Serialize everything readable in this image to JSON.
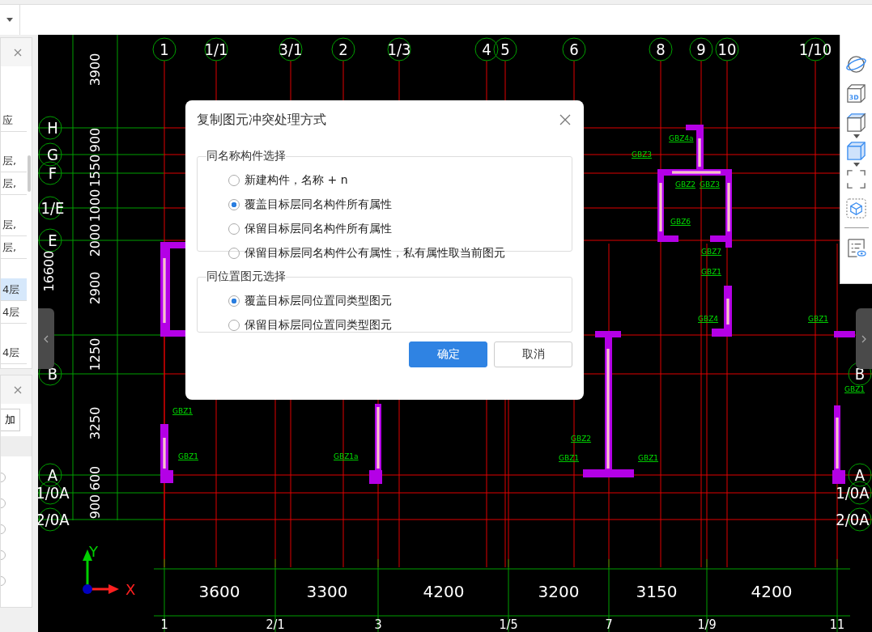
{
  "left_panels": [
    {
      "rows": [
        {
          "text": "应",
          "selected": false
        },
        {
          "text": "层,",
          "selected": false
        },
        {
          "text": "层,",
          "selected": false
        },
        {
          "text": "层,",
          "selected": false
        },
        {
          "text": "层,",
          "selected": false
        },
        {
          "text": "4层",
          "selected": true
        },
        {
          "text": "4层",
          "selected": false
        },
        {
          "text": "4层",
          "selected": false
        }
      ]
    },
    {
      "button": "加",
      "options": [
        {
          "selected": false
        },
        {
          "selected": false
        },
        {
          "selected": false
        },
        {
          "selected": false
        },
        {
          "selected": false
        }
      ]
    }
  ],
  "drawing": {
    "top_axes": [
      "1",
      "1/1",
      "3/1",
      "2",
      "1/3",
      "4",
      "5",
      "6",
      "8",
      "9",
      "10",
      "1/10"
    ],
    "bottom_axes": [
      "1",
      "2/1",
      "3",
      "1/5",
      "7",
      "1/9",
      "11"
    ],
    "left_axes": [
      "H",
      "G",
      "F",
      "1/E",
      "E",
      "B",
      "A",
      "1/0A",
      "2/0A"
    ],
    "right_axes": [
      "B",
      "A",
      "1/0A",
      "2/0A"
    ],
    "left_dimensions": [
      "3900",
      "900",
      "1550",
      "1000",
      "2000",
      "16600",
      "2900",
      "1250",
      "3250",
      "600",
      "900"
    ],
    "bottom_dimensions": [
      "3600",
      "3300",
      "4200",
      "3200",
      "3150",
      "4200"
    ],
    "wall_labels": [
      "GBZ4a",
      "GBZ3",
      "GBZ2",
      "GBZ3",
      "GBZ6",
      "GBZ7",
      "GBZ1",
      "GBZ4",
      "GBZ1",
      "GBZ2",
      "GBZ1",
      "GBZ1",
      "GBZ1",
      "GBZ1",
      "GBZ1a",
      "GBZ1"
    ],
    "axis_x": "X",
    "axis_y": "Y"
  },
  "toolbar": [
    {
      "kind": "orbit"
    },
    {
      "kind": "cube3d",
      "label": "3D"
    },
    {
      "kind": "cube"
    },
    {
      "kind": "caret"
    },
    {
      "kind": "cube-filled"
    },
    {
      "kind": "caret"
    },
    {
      "kind": "frame"
    },
    {
      "kind": "cube-frame"
    },
    {
      "kind": "divider"
    },
    {
      "kind": "list-eye"
    }
  ],
  "dialog": {
    "title": "复制图元冲突处理方式",
    "groups": [
      {
        "legend": "同名称构件选择",
        "options": [
          {
            "label": "新建构件，名称 + n",
            "selected": false
          },
          {
            "label": "覆盖目标层同名构件所有属性",
            "selected": true
          },
          {
            "label": "保留目标层同名构件所有属性",
            "selected": false
          },
          {
            "label": "保留目标层同名构件公有属性，私有属性取当前图元",
            "selected": false
          }
        ]
      },
      {
        "legend": "同位置图元选择",
        "options": [
          {
            "label": "覆盖目标层同位置同类型图元",
            "selected": true
          },
          {
            "label": "保留目标层同位置同类型图元",
            "selected": false
          }
        ]
      }
    ],
    "buttons": [
      {
        "label": "确定",
        "primary": true
      },
      {
        "label": "取消",
        "primary": false
      }
    ]
  }
}
